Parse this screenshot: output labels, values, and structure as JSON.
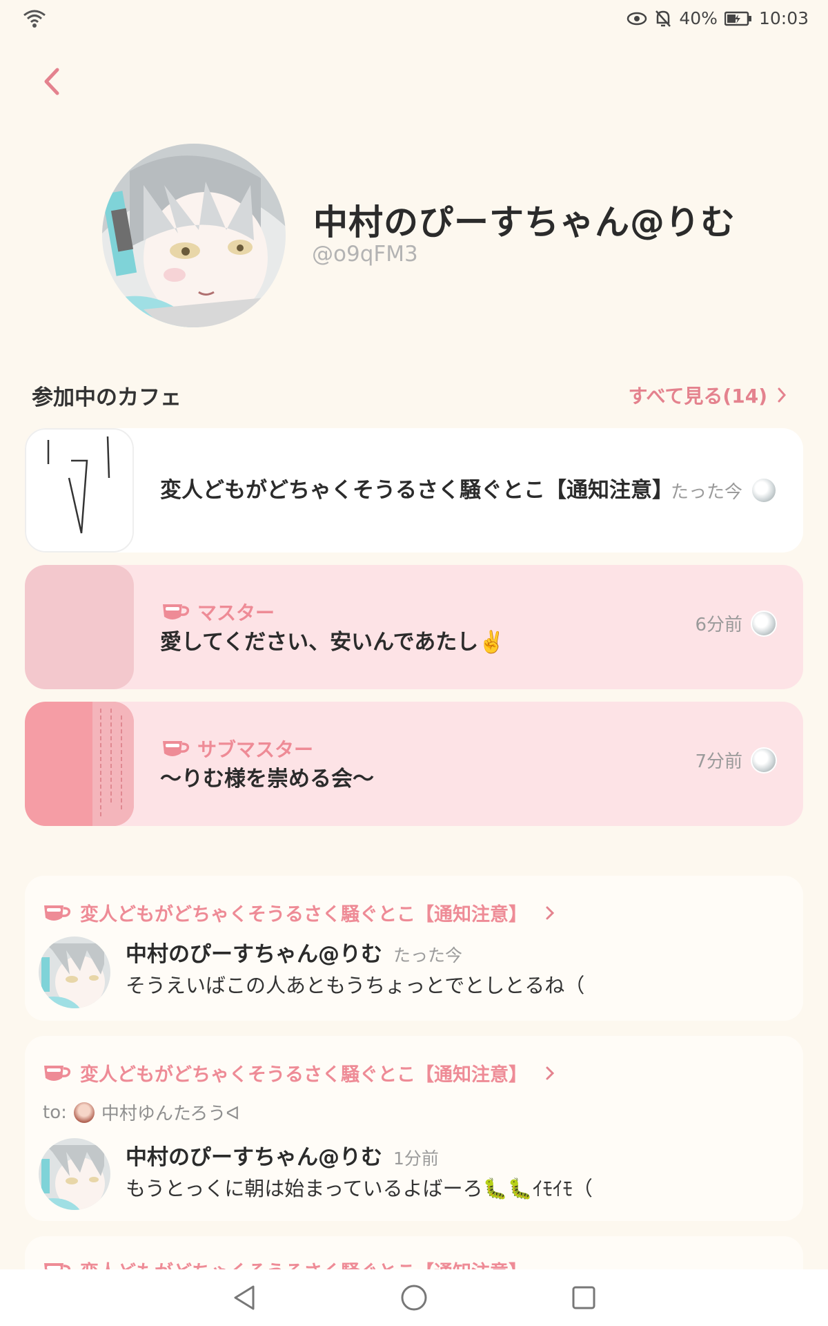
{
  "status_bar": {
    "battery": "40%",
    "time": "10:03"
  },
  "profile": {
    "name": "中村のぴーすちゃん@りむ",
    "user_id": "@o9qFM3"
  },
  "cafes_section": {
    "title": "参加中のカフェ",
    "see_all": "すべて見る(14)"
  },
  "cafes": [
    {
      "name": "変人どもがどちゃくそうるさく騒ぐとこ【通知注意】",
      "role": "",
      "time": "たった今"
    },
    {
      "name": "愛してください、安いんであたし✌️",
      "role": "マスター",
      "time": "6分前"
    },
    {
      "name": "〜りむ様を崇める会〜",
      "role": "サブマスター",
      "time": "7分前"
    }
  ],
  "posts": [
    {
      "cafe": "変人どもがどちゃくそうるさく騒ぐとこ【通知注意】",
      "to_label": "",
      "to_name": "",
      "author": "中村のぴーすちゃん@りむ",
      "time": "たった今",
      "text": "そうえいばこの人あともうちょっとでとしとるね（"
    },
    {
      "cafe": "変人どもがどちゃくそうるさく騒ぐとこ【通知注意】",
      "to_label": "to:",
      "to_name": "中村ゆんたろうᐊ",
      "author": "中村のぴーすちゃん@りむ",
      "time": "1分前",
      "text": "もうとっくに朝は始まっているよばーろ🐛🐛ｲﾓｲﾓ（"
    },
    {
      "cafe": "変人どもがどちゃくそうるさく騒ぐとこ【通知注意】"
    }
  ],
  "colors": {
    "background": "#fdf8ef",
    "accent": "#ee8b96",
    "card_pink": "#fde3e6"
  }
}
